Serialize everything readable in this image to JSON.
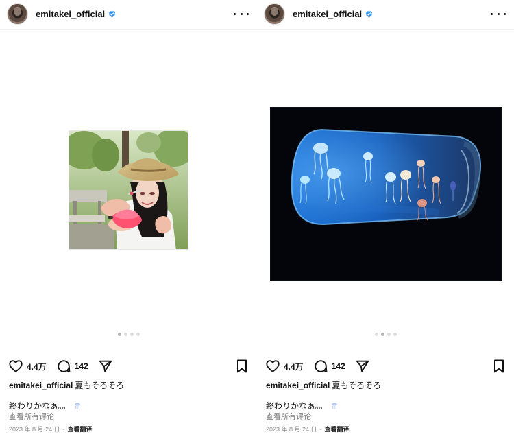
{
  "posts": [
    {
      "account": {
        "username": "emitakei_official"
      },
      "actions": {
        "like_count": "4.4万",
        "comment_count": "142"
      },
      "caption": {
        "username": "emitakei_official",
        "line1": "夏もそろそろ",
        "line2": "終わりかなぁ。。"
      },
      "comments_link": "查看所有评论",
      "date": "2023 年 8 月 24 日",
      "separator": "·",
      "translate_label": "查看翻译",
      "media_kind": "portrait-photo"
    },
    {
      "account": {
        "username": "emitakei_official"
      },
      "actions": {
        "like_count": "4.4万",
        "comment_count": "142"
      },
      "caption": {
        "username": "emitakei_official",
        "line1": "夏もそろそろ",
        "line2": "終わりかなぁ。。"
      },
      "comments_link": "查看所有评论",
      "date": "2023 年 8 月 24 日",
      "separator": "·",
      "translate_label": "查看翻译",
      "media_kind": "jellyfish-aquarium-photo"
    }
  ],
  "colors": {
    "verified_blue": "#3897f0",
    "text": "#111111",
    "secondary_text": "#8a8a8a"
  },
  "icons": {
    "more": "more-options-icon",
    "like": "heart-icon",
    "comment": "comment-icon",
    "share": "send-icon",
    "bookmark": "bookmark-icon",
    "verified": "verified-badge-icon",
    "emoji": "jellyfish-icon"
  }
}
